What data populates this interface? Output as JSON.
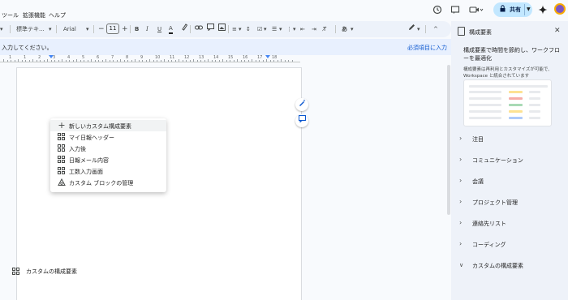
{
  "menu": [
    "ツール",
    "拡張機能",
    "ヘルプ"
  ],
  "share": {
    "label": "共有"
  },
  "toolbar": {
    "style": "標準テキ...",
    "font": "Arial",
    "font_size": "11",
    "text_color": "#1f1f1f"
  },
  "notice": {
    "message": "入力してください。",
    "link": "必須項目に入力"
  },
  "ruler": [
    "1",
    "1",
    "2",
    "3",
    "4",
    "5",
    "6",
    "7",
    "8",
    "9",
    "10",
    "11",
    "12",
    "13",
    "14",
    "15",
    "16",
    "17",
    "18"
  ],
  "popup": {
    "items": [
      {
        "label": "新しいカスタム構成要素",
        "icon": "plus-icon"
      },
      {
        "label": "マイ日報ヘッダー",
        "icon": "building-block-icon"
      },
      {
        "label": "入力後",
        "icon": "building-block-icon"
      },
      {
        "label": "日報メール内容",
        "icon": "building-block-icon"
      },
      {
        "label": "工数入力画面",
        "icon": "building-block-icon"
      },
      {
        "label": "カスタム ブロックの管理",
        "icon": "manage-blocks-icon"
      }
    ]
  },
  "panel": {
    "title": "構成要素",
    "headline": "構成要素で時間を節約し、ワークフローを最適化",
    "description": "構成要素は再利用とカスタマイズが可能で、Workspace と統合されています",
    "sections": [
      "注目",
      "コミュニケーション",
      "会議",
      "プロジェクト管理",
      "連絡先リスト",
      "コーディング",
      "カスタムの構成要素"
    ],
    "sub_item": "カスタムの構成要素"
  },
  "colors": {
    "accent": "#0b57d0",
    "share_bg": "#c2e7ff",
    "notice_bg": "#e8f0fe",
    "panel_bg": "#eef2f9"
  }
}
